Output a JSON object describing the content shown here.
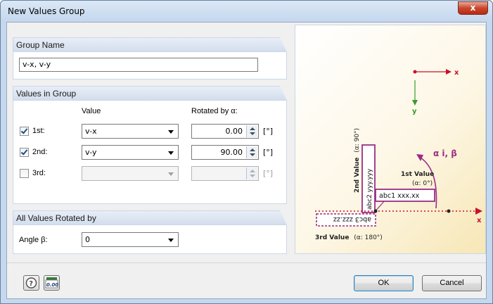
{
  "window": {
    "title": "New Values Group",
    "close_glyph": "x"
  },
  "group_name": {
    "header": "Group Name",
    "value": "v-x, v-y"
  },
  "values_in_group": {
    "header": "Values in Group",
    "value_col": "Value",
    "rotated_col": "Rotated by α:",
    "rows": [
      {
        "label": "1st:",
        "checked": true,
        "value": "v-x",
        "angle": "0.00",
        "unit": "[°]",
        "enabled": true
      },
      {
        "label": "2nd:",
        "checked": true,
        "value": "v-y",
        "angle": "90.00",
        "unit": "[°]",
        "enabled": true
      },
      {
        "label": "3rd:",
        "checked": false,
        "value": "",
        "angle": "",
        "unit": "[°]",
        "enabled": false
      }
    ]
  },
  "all_values_rotated": {
    "header": "All Values Rotated by",
    "angle_label": "Angle β:",
    "angle_value": "0"
  },
  "buttons": {
    "ok": "OK",
    "cancel": "Cancel"
  },
  "icons": {
    "help": "help-icon",
    "decimals": "decimal-places-icon"
  },
  "decimals_icon_text": "0.00",
  "figure": {
    "axis_x": "x",
    "axis_y": "y",
    "alpha_beta": "α i, β",
    "first_value": "1st Value",
    "first_alpha": "(α: 0°)",
    "first_text": "abc1 xxx.xx",
    "second_value": "2nd Value",
    "second_alpha": "(α: 90°)",
    "second_text": "abc2 yyy.yyy",
    "third_value": "3rd Value",
    "third_alpha": "(α: 180°)",
    "third_text": "abc3 zzz.zz",
    "colors": {
      "purple": "#9b2d86",
      "red": "#c8102e",
      "green": "#3a9a2c"
    }
  }
}
